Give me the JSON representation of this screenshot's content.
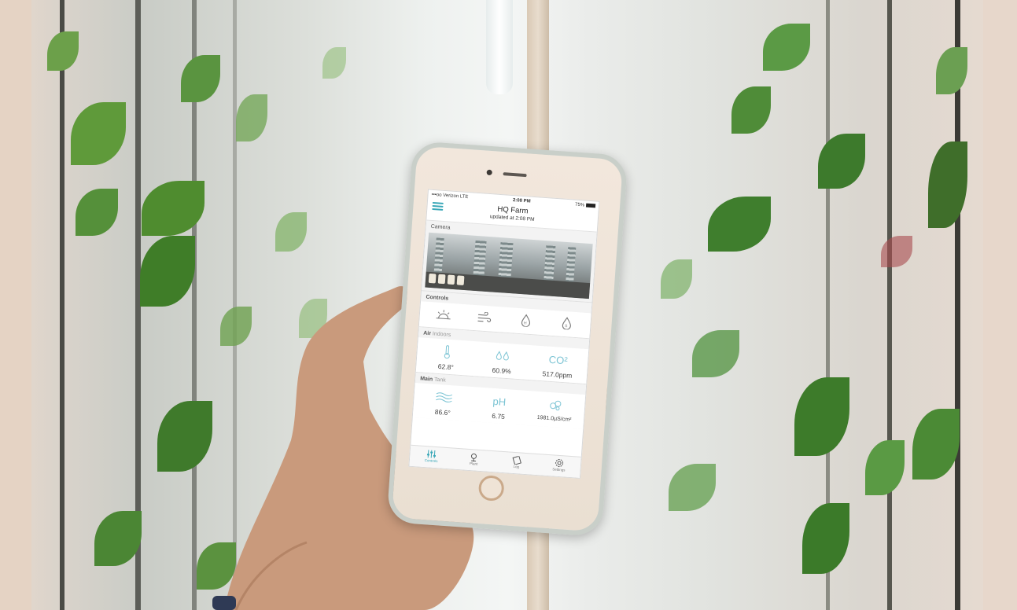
{
  "statusbar": {
    "carrier": "•••oo Verizon  LTE",
    "time": "2:08 PM",
    "battery": "75%"
  },
  "app": {
    "title": "HQ Farm",
    "subtitle": "updated at 2:08 PM"
  },
  "camera": {
    "heading": "Camera"
  },
  "controls": {
    "heading": "Controls",
    "icons": [
      "light-icon",
      "fan-icon",
      "humidity-icon",
      "nutrient-drop-icon"
    ]
  },
  "air": {
    "heading_bold": "Air",
    "heading_light": "Indoors",
    "temperature": "62.8°",
    "humidity": "60.9%",
    "co2_label": "CO²",
    "co2": "517.0ppm"
  },
  "tank": {
    "heading_bold": "Main",
    "heading_light": "Tank",
    "temperature": "86.6°",
    "ph_label": "pH",
    "ph": "6.75",
    "ec": "1981.0µS/cm²"
  },
  "tabs": [
    {
      "label": "Controls",
      "icon": "sliders-icon"
    },
    {
      "label": "Plant",
      "icon": "plant-icon"
    },
    {
      "label": "Log",
      "icon": "notebook-icon"
    },
    {
      "label": "Settings",
      "icon": "gear-icon"
    }
  ],
  "colors": {
    "accent": "#3aa8b8",
    "icon_light": "#7cc4d4"
  }
}
